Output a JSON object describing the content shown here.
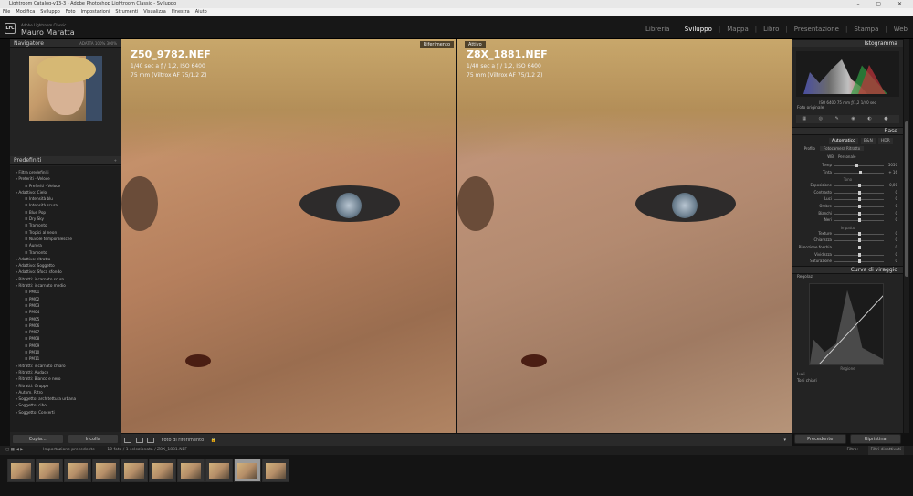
{
  "window": {
    "title": "Lightroom Catalog-v13-3 - Adobe Photoshop Lightroom Classic - Sviluppo"
  },
  "menu": [
    "File",
    "Modifica",
    "Sviluppo",
    "Foto",
    "Impostazioni",
    "Strumenti",
    "Visualizza",
    "Finestra",
    "Aiuto"
  ],
  "identity": {
    "app": "Adobe Lightroom Classic",
    "user": "Mauro Maratta"
  },
  "modules": [
    "Libreria",
    "Sviluppo",
    "Mappa",
    "Libro",
    "Presentazione",
    "Stampa",
    "Web"
  ],
  "left": {
    "navigator": {
      "title": "Navigatore",
      "zoom": [
        "ADATTA",
        "100%",
        "300%"
      ]
    },
    "presets": {
      "title": "Predefiniti",
      "items": [
        {
          "t": "Filtra predefiniti",
          "lvl": 0
        },
        {
          "t": "Preferiti - Veloce",
          "lvl": 0
        },
        {
          "t": "Preferiti - Veloce",
          "lvl": 1
        },
        {
          "t": "Adattivo: Cielo",
          "lvl": 0
        },
        {
          "t": "Intensità blu",
          "lvl": 1
        },
        {
          "t": "Intensità scura",
          "lvl": 1
        },
        {
          "t": "Blue Pop",
          "lvl": 1
        },
        {
          "t": "Dry Sky",
          "lvl": 1
        },
        {
          "t": "Tramonto",
          "lvl": 1
        },
        {
          "t": "Tropici al neon",
          "lvl": 1
        },
        {
          "t": "Nuvole temporalesche",
          "lvl": 1
        },
        {
          "t": "Aurora",
          "lvl": 1
        },
        {
          "t": "Tramonto",
          "lvl": 1
        },
        {
          "t": "Adattivo: ritratto",
          "lvl": 0
        },
        {
          "t": "Adattivo: Soggetto",
          "lvl": 0
        },
        {
          "t": "Adattivo: Sfoca sfondo",
          "lvl": 0
        },
        {
          "t": "Ritratti: incarnato scuro",
          "lvl": 0
        },
        {
          "t": "Ritratti: incarnato medio",
          "lvl": 0
        },
        {
          "t": "PM01",
          "lvl": 1
        },
        {
          "t": "PM02",
          "lvl": 1
        },
        {
          "t": "PM03",
          "lvl": 1
        },
        {
          "t": "PM04",
          "lvl": 1
        },
        {
          "t": "PM05",
          "lvl": 1
        },
        {
          "t": "PM06",
          "lvl": 1
        },
        {
          "t": "PM07",
          "lvl": 1
        },
        {
          "t": "PM08",
          "lvl": 1
        },
        {
          "t": "PM09",
          "lvl": 1
        },
        {
          "t": "PM10",
          "lvl": 1
        },
        {
          "t": "PM11",
          "lvl": 1
        },
        {
          "t": "Ritratti: incarnato chiaro",
          "lvl": 0
        },
        {
          "t": "Ritratti: Audace",
          "lvl": 0
        },
        {
          "t": "Ritratti: Bianco e nero",
          "lvl": 0
        },
        {
          "t": "Ritratti: Gruppo",
          "lvl": 0
        },
        {
          "t": "Autom. Ritro",
          "lvl": 0
        },
        {
          "t": "Soggetto: architettura urbana",
          "lvl": 0
        },
        {
          "t": "Soggetto: cibo",
          "lvl": 0
        },
        {
          "t": "Soggetto: Concerti",
          "lvl": 0
        }
      ]
    },
    "copy": "Copia...",
    "paste": "Incolla"
  },
  "photos": [
    {
      "tag": "Riferimento",
      "name": "Z50_9782.NEF",
      "exp": "1/40 sec a ƒ / 1,2, ISO 6400",
      "lens": "75 mm (Viltrox AF 75/1.2 Z)"
    },
    {
      "tag": "Attivo",
      "name": "Z8X_1881.NEF",
      "exp": "1/40 sec a ƒ / 1,2, ISO 6400",
      "lens": "75 mm (Viltrox AF 75/1.2 Z)"
    }
  ],
  "toolbar": {
    "label": "Foto di riferimento"
  },
  "right": {
    "histogram": {
      "title": "Istogramma",
      "vals": [
        "ISO 6400",
        "75 mm",
        "ƒ/1,2",
        "1/40 sec"
      ],
      "orig": "Foto originale"
    },
    "basic": {
      "title": "Base",
      "profile_btns": [
        "Automatico",
        "B&N",
        "HDR"
      ],
      "profile_label": "Profilo",
      "profile_value": "Fotocamera Ritratto",
      "wb_label": "WB",
      "wb_value": "Personale",
      "sliders": [
        {
          "l": "Temp",
          "v": "5050",
          "p": 0.45
        },
        {
          "l": "Tinta",
          "v": "+ 16",
          "p": 0.52
        }
      ],
      "tone_hdr": "Tono",
      "tone": [
        {
          "l": "Esposizione",
          "v": "0,00",
          "p": 0.5
        },
        {
          "l": "Contrasto",
          "v": "0",
          "p": 0.5
        },
        {
          "l": "Luci",
          "v": "0",
          "p": 0.5
        },
        {
          "l": "Ombre",
          "v": "0",
          "p": 0.5
        },
        {
          "l": "Bianchi",
          "v": "0",
          "p": 0.5
        },
        {
          "l": "Neri",
          "v": "0",
          "p": 0.5
        }
      ],
      "presence_hdr": "Impatto",
      "presence": [
        {
          "l": "Texture",
          "v": "0",
          "p": 0.5
        },
        {
          "l": "Chiarezza",
          "v": "0",
          "p": 0.5
        },
        {
          "l": "Rimozione foschia",
          "v": "0",
          "p": 0.5
        },
        {
          "l": "Vividezza",
          "v": "0",
          "p": 0.5
        },
        {
          "l": "Saturazione",
          "v": "0",
          "p": 0.5
        }
      ]
    },
    "curve": {
      "title": "Curva di viraggio",
      "mode": "Regolaz.",
      "region": "Regione",
      "lights": "Luci",
      "toni": "Toni chiari"
    },
    "prev": "Precedente",
    "reset": "Ripristina"
  },
  "filmbar": {
    "prev": "Importazione precedente",
    "count": "10 foto / 1 selezionata /",
    "file": "Z8X_1881.NEF",
    "filter": "Filtro:",
    "filter_value": "Filtri disattivati"
  },
  "film_count": 10,
  "film_selected": 8
}
